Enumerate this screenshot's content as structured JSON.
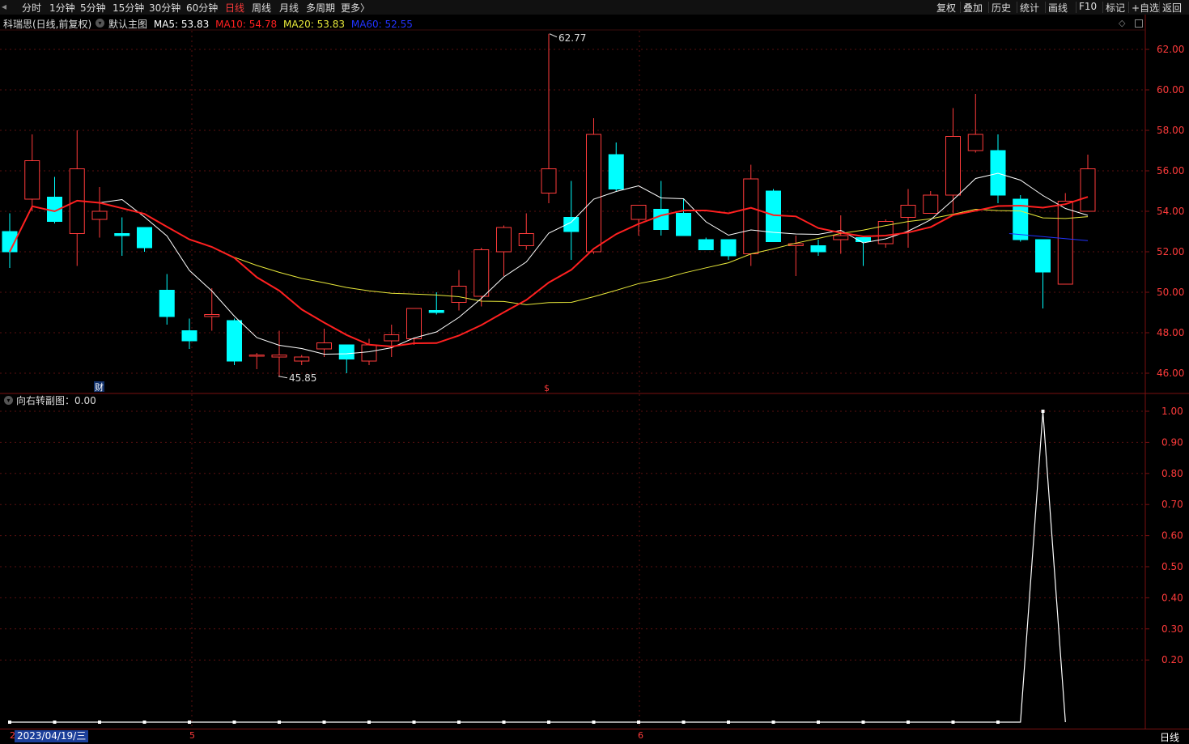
{
  "toolbar": {
    "periods": [
      "分时",
      "1分钟",
      "5分钟",
      "15分钟",
      "30分钟",
      "60分钟",
      "日线",
      "周线",
      "月线",
      "多周期",
      "更多〉"
    ],
    "active_period": "日线",
    "tools": [
      "复权",
      "叠加",
      "历史",
      "统计",
      "画线",
      "F10",
      "标记",
      "+自选",
      "返回"
    ]
  },
  "legend": {
    "stock_label": "科瑞思(日线,前复权)",
    "template_label": "默认主图",
    "ma5": "MA5: 53.83",
    "ma10": "MA10: 54.78",
    "ma20": "MA20: 53.83",
    "ma60": "MA60: 52.55",
    "colors": {
      "ma5": "#ffffff",
      "ma10": "#ff2020",
      "ma20": "#e8e83a",
      "ma60": "#2233ff",
      "up": "#ff3b3b",
      "down": "#00ffff"
    }
  },
  "main_chart": {
    "y_ticks": [
      "62.00",
      "60.00",
      "58.00",
      "56.00",
      "54.00",
      "52.00",
      "50.00",
      "48.00",
      "46.00"
    ],
    "high_marker": "62.77",
    "low_marker": "45.85",
    "fin_marker": "财",
    "dollar_marker": "$"
  },
  "sub_chart": {
    "title": "向右转副图：0.00",
    "y_ticks": [
      "1.00",
      "0.90",
      "0.80",
      "0.70",
      "0.60",
      "0.50",
      "0.40",
      "0.30",
      "0.20"
    ]
  },
  "bottom": {
    "month_marks": [
      "2",
      "5",
      "6"
    ],
    "date": "2023/04/19/三",
    "period_label": "日线"
  },
  "chart_data": [
    {
      "type": "candlestick",
      "ohlc": [
        [
          53.0,
          52.0,
          51.2,
          53.9
        ],
        [
          54.6,
          56.5,
          54.0,
          57.8
        ],
        [
          54.7,
          53.5,
          53.4,
          55.7
        ],
        [
          52.9,
          56.1,
          51.3,
          58.0
        ],
        [
          53.6,
          54.0,
          52.7,
          55.2
        ],
        [
          52.9,
          52.8,
          51.8,
          53.7
        ],
        [
          53.2,
          52.2,
          52.0,
          52.3
        ],
        [
          50.1,
          48.8,
          48.4,
          50.9
        ],
        [
          48.1,
          47.6,
          47.2,
          48.7
        ],
        [
          48.8,
          48.9,
          48.1,
          50.2
        ],
        [
          48.6,
          46.6,
          46.4,
          48.7
        ],
        [
          46.9,
          46.9,
          46.2,
          47.0
        ],
        [
          46.8,
          46.9,
          45.85,
          48.1
        ],
        [
          46.6,
          46.8,
          46.4,
          46.9
        ],
        [
          47.2,
          47.5,
          46.8,
          48.2
        ],
        [
          47.4,
          46.7,
          46.0,
          47.4
        ],
        [
          46.6,
          47.4,
          46.4,
          47.7
        ],
        [
          47.6,
          47.9,
          46.8,
          48.4
        ],
        [
          47.7,
          49.2,
          47.4,
          49.2
        ],
        [
          49.1,
          49.0,
          48.9,
          50.0
        ],
        [
          49.5,
          50.3,
          49.1,
          51.1
        ],
        [
          49.8,
          52.1,
          49.3,
          52.2
        ],
        [
          52.0,
          53.2,
          50.8,
          53.3
        ],
        [
          52.3,
          52.9,
          52.1,
          53.9
        ],
        [
          54.9,
          56.1,
          54.4,
          62.77
        ],
        [
          53.7,
          53.0,
          51.6,
          55.5
        ],
        [
          52.0,
          57.8,
          51.9,
          58.6
        ],
        [
          56.8,
          55.1,
          55.0,
          57.4
        ],
        [
          53.6,
          54.3,
          52.8,
          54.3
        ],
        [
          54.1,
          53.1,
          52.8,
          55.5
        ],
        [
          53.9,
          52.8,
          52.8,
          54.6
        ],
        [
          52.6,
          52.1,
          52.1,
          52.7
        ],
        [
          52.6,
          51.8,
          51.6,
          52.6
        ],
        [
          51.9,
          55.6,
          51.3,
          56.3
        ],
        [
          55.0,
          52.5,
          52.5,
          55.1
        ],
        [
          52.3,
          52.4,
          50.8,
          52.8
        ],
        [
          52.3,
          52.0,
          51.8,
          52.6
        ],
        [
          52.6,
          52.8,
          51.9,
          53.8
        ],
        [
          52.7,
          52.5,
          51.3,
          52.7
        ],
        [
          52.4,
          53.5,
          52.2,
          53.6
        ],
        [
          53.7,
          54.3,
          52.2,
          55.1
        ],
        [
          53.9,
          54.8,
          53.9,
          55.0
        ],
        [
          54.8,
          57.7,
          53.9,
          59.1
        ],
        [
          57.0,
          57.8,
          56.9,
          59.8
        ],
        [
          57.0,
          54.8,
          54.4,
          57.8
        ],
        [
          54.6,
          52.6,
          52.5,
          54.8
        ],
        [
          52.6,
          51.0,
          49.2,
          52.6
        ],
        [
          50.4,
          54.5,
          50.4,
          54.9
        ],
        [
          54.0,
          56.1,
          54.0,
          56.8
        ]
      ],
      "ma5": [
        52.4,
        null,
        53.6,
        53.8,
        null,
        54.5,
        null,
        null,
        null,
        null,
        null,
        null,
        null,
        47.0,
        null,
        null,
        null,
        null,
        null,
        null,
        null,
        null,
        null,
        null,
        null,
        null,
        null,
        null,
        null,
        null,
        null,
        null,
        null,
        null,
        null,
        null,
        null,
        null,
        null,
        null,
        null,
        null,
        null,
        null,
        null,
        null,
        null,
        null,
        53.83
      ],
      "ma10": [
        52.9,
        null,
        52.9,
        53.1,
        null,
        53.5,
        null,
        null,
        null,
        null,
        null,
        null,
        null,
        null,
        null,
        null,
        null,
        null,
        null,
        null,
        null,
        null,
        null,
        null,
        null,
        null,
        null,
        null,
        null,
        null,
        null,
        null,
        null,
        null,
        null,
        null,
        null,
        null,
        null,
        null,
        null,
        null,
        null,
        null,
        null,
        null,
        null,
        null,
        54.78
      ],
      "ma20": [
        null,
        null,
        null,
        null,
        55.5,
        null,
        null,
        null,
        null,
        null,
        null,
        null,
        null,
        null,
        null,
        null,
        null,
        null,
        null,
        null,
        null,
        null,
        null,
        null,
        null,
        null,
        null,
        null,
        null,
        null,
        null,
        null,
        null,
        null,
        null,
        null,
        null,
        null,
        null,
        null,
        null,
        null,
        null,
        null,
        null,
        null,
        null,
        null,
        53.83
      ],
      "ma60": [
        null,
        null,
        null,
        null,
        null,
        null,
        null,
        null,
        null,
        null,
        null,
        null,
        null,
        null,
        null,
        null,
        null,
        null,
        null,
        null,
        null,
        null,
        null,
        null,
        null,
        null,
        null,
        null,
        null,
        null,
        null,
        null,
        null,
        null,
        null,
        null,
        null,
        null,
        null,
        null,
        null,
        null,
        null,
        null,
        52.9,
        null,
        null,
        null,
        52.55
      ],
      "ylim": [
        45.5,
        63.2
      ]
    },
    {
      "type": "line",
      "values": [
        0,
        0,
        0,
        0,
        0,
        0,
        0,
        0,
        0,
        0,
        0,
        0,
        0,
        0,
        0,
        0,
        0,
        0,
        0,
        0,
        0,
        0,
        0,
        0,
        0,
        0,
        0,
        0,
        0,
        0,
        0,
        0,
        0,
        0,
        0,
        0,
        0,
        0,
        0,
        0,
        0,
        0,
        0,
        0,
        0,
        0,
        1,
        0
      ],
      "ylim": [
        0,
        1.05
      ]
    }
  ]
}
